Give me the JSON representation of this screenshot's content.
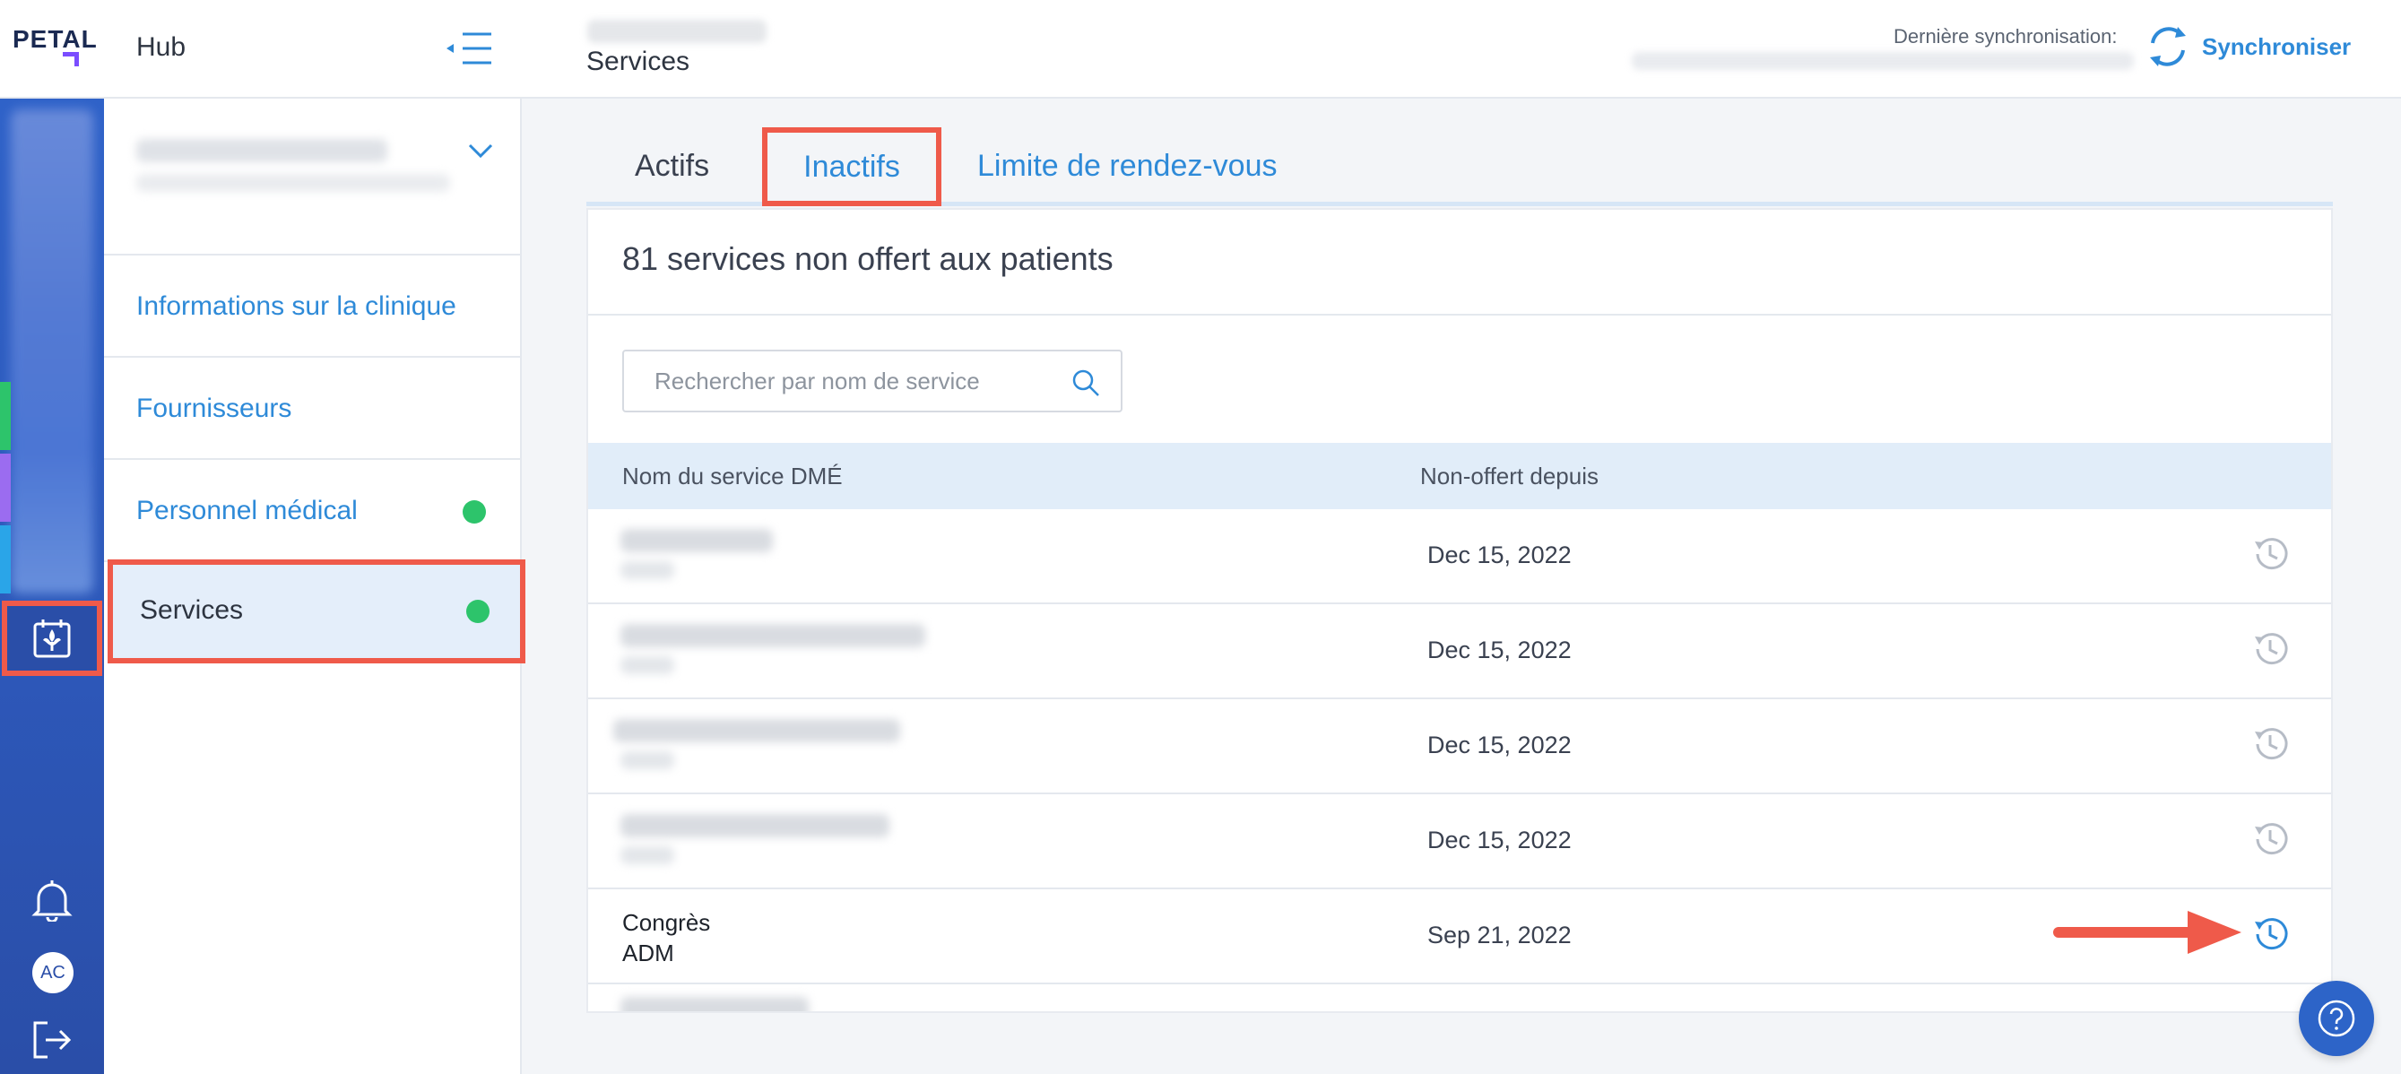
{
  "app": {
    "logo_text": "PETAL",
    "hub_title": "Hub",
    "page_title": "Services"
  },
  "sync": {
    "label": "Dernière synchronisation:",
    "button": "Synchroniser"
  },
  "subnav": {
    "items": [
      {
        "label": "Informations sur la clinique",
        "status": ""
      },
      {
        "label": "Fournisseurs",
        "status": ""
      },
      {
        "label": "Personnel médical",
        "status": "green"
      },
      {
        "label": "Services",
        "status": "green",
        "active": true
      }
    ]
  },
  "rail": {
    "avatar_initials": "AC",
    "stripe_colors": [
      "#2dc46b",
      "#9b6cf0",
      "#2aa5e8"
    ]
  },
  "tabs": [
    "Actifs",
    "Inactifs",
    "Limite de rendez-vous"
  ],
  "active_tab": "Inactifs",
  "card": {
    "title": "81 services non offert aux patients"
  },
  "search": {
    "placeholder": "Rechercher par nom de service"
  },
  "table": {
    "headers": [
      "Nom du service DMÉ",
      "Non-offert depuis"
    ],
    "rows": [
      {
        "name": "",
        "code": "",
        "date": "Dec 15, 2022"
      },
      {
        "name": "",
        "code": "",
        "date": "Dec 15, 2022"
      },
      {
        "name": "",
        "code": "",
        "date": "Dec 15, 2022"
      },
      {
        "name": "",
        "code": "",
        "date": "Dec 15, 2022"
      },
      {
        "name": "Congrès",
        "code": "ADM",
        "date": "Sep 21, 2022",
        "highlight": true
      }
    ]
  },
  "colors": {
    "accent": "#2e8ad8",
    "rail": "#2d57b8",
    "status_green": "#2dc46b",
    "annotation": "#ef5a4a"
  }
}
